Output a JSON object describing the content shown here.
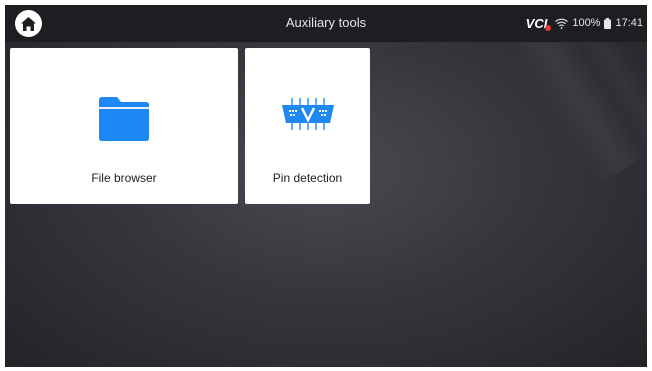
{
  "header": {
    "title": "Auxiliary tools",
    "home_icon": "home-icon"
  },
  "status": {
    "vci_label": "VCI",
    "wifi_icon": "wifi-icon",
    "battery_percent": "100%",
    "battery_icon": "battery-icon",
    "time": "17:41"
  },
  "tiles": [
    {
      "label": "File browser",
      "icon": "folder-icon",
      "icon_color": "#1e88f5"
    },
    {
      "label": "Pin detection",
      "icon": "pin-connector-icon",
      "icon_color": "#1e88f5"
    }
  ],
  "colors": {
    "status_bar": "#1e1e22",
    "background": "#36363d",
    "accent": "#1e88f5",
    "vci_alert": "#e53935"
  }
}
